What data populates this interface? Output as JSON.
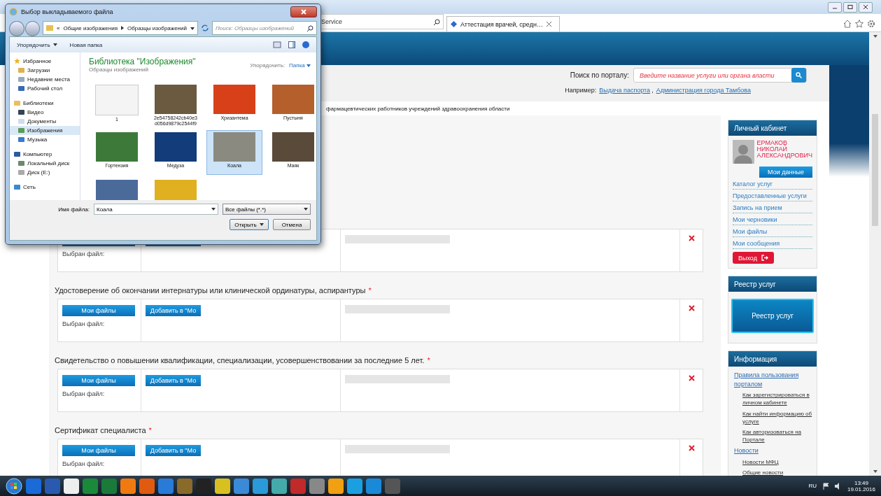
{
  "browser": {
    "address": "Service",
    "tab": {
      "title": "Аттестация врачей, средн…",
      "selected": true
    }
  },
  "portal": {
    "search_label": "Поиск по порталу:",
    "search_placeholder": "Введите название услуги или органа власти",
    "example_label": "Например:",
    "example_links": [
      "Выдача паспорта",
      "Администрация города Тамбова"
    ],
    "example_separator": ",",
    "breadcrumb": "фармацевтических работников учреждений здравоохранения области"
  },
  "sections": [
    {
      "selected_label": "Выбран файл:"
    },
    {
      "title": "Удостоверение об окончании интернатуры или клинической ординатуры, аспирантуры",
      "required_mark": "*",
      "files_button": "Мои файлы",
      "selected_label": "Выбран файл:",
      "add_button": "Добавить в \"Мо"
    },
    {
      "title": "Свидетельство о повышении квалификации, специализации, усовершенствовании за последние 5 лет.",
      "required_mark": "*",
      "files_button": "Мои файлы",
      "selected_label": "Выбран файл:",
      "add_button": "Добавить в \"Мо"
    },
    {
      "title": "Сертификат специалиста",
      "required_mark": "*",
      "files_button": "Мои файлы",
      "selected_label": "Выбран файл:",
      "add_button": "Добавить в \"Мо"
    }
  ],
  "sidebar": {
    "cabinet": {
      "title": "Личный кабинет",
      "name_lines": [
        "ЕРМАКОВ",
        "НИКОЛАЙ",
        "АЛЕКСАНДРОВИЧ"
      ],
      "data_button": "Мои данные",
      "links": [
        "Каталог услуг",
        "Предоставленные услуги",
        "Запись на прием",
        "Мои черновики",
        "Мои файлы",
        "Мои сообщения"
      ],
      "logout": "Выход"
    },
    "registry": {
      "title": "Реестр услуг",
      "button": "Реестр услуг"
    },
    "info": {
      "title": "Информация",
      "links": [
        {
          "label": "Правила пользования порталом",
          "children": [
            {
              "label": "Как зарегистрироваться в личном кабинете"
            },
            {
              "label": "Как найти информацию об услуге"
            },
            {
              "label": "Как авторизоваться на Портале"
            }
          ]
        },
        {
          "label": "Новости",
          "children": [
            {
              "label": "Новости МФЦ"
            },
            {
              "label": "Общие новости"
            }
          ]
        }
      ]
    }
  },
  "dialog": {
    "title": "Выбор выкладываемого файла",
    "path_prefix": "«",
    "path": [
      "Общие изображения",
      "Образцы изображений"
    ],
    "search_placeholder": "Поиск: Образцы изображений",
    "toolbar": [
      {
        "label": "Упорядочить",
        "kind": "menu"
      },
      {
        "label": "Новая папка",
        "kind": "plain"
      }
    ],
    "nav": [
      {
        "label": "Избранное",
        "kind": "star",
        "selected": false,
        "children": [
          {
            "label": "Загрузки",
            "kind": "folder",
            "selected": false
          },
          {
            "label": "Недавние места",
            "kind": "places",
            "selected": false
          },
          {
            "label": "Рабочий стол",
            "kind": "desktop",
            "selected": false
          }
        ]
      },
      {
        "label": "Библиотеки",
        "kind": "library",
        "selected": false,
        "children": [
          {
            "label": "Видео",
            "kind": "video",
            "selected": false
          },
          {
            "label": "Документы",
            "kind": "document",
            "selected": false
          },
          {
            "label": "Изображения",
            "kind": "image",
            "selected": true
          },
          {
            "label": "Музыка",
            "kind": "music",
            "selected": false
          }
        ]
      },
      {
        "label": "Компьютер",
        "kind": "computer",
        "selected": false,
        "children": [
          {
            "label": "Локальный диск",
            "kind": "drive",
            "selected": false
          },
          {
            "label": "Диск (E:)",
            "kind": "disk",
            "selected": false
          }
        ]
      },
      {
        "label": "Сеть",
        "kind": "network",
        "selected": false
      }
    ],
    "library_title": "Библиотека \"Изображения\"",
    "library_subtitle": "Образцы изображений",
    "arrange_label": "Упорядочить:",
    "arrange_value": "Папка",
    "files": [
      {
        "label": "1",
        "kind": "document",
        "selected": false
      },
      {
        "label": "2e54758242cb40e3d056d9879c2544f9",
        "kind": "photo",
        "selected": false
      },
      {
        "label": "Хризантема",
        "kind": "photo",
        "selected": false
      },
      {
        "label": "Пустыня",
        "kind": "photo",
        "selected": false
      },
      {
        "label": "Гортензия",
        "kind": "photo",
        "selected": false
      },
      {
        "label": "Медуза",
        "kind": "photo",
        "selected": false
      },
      {
        "label": "Коала",
        "kind": "photo",
        "selected": true
      },
      {
        "label": "Маяк",
        "kind": "photo",
        "selected": false
      },
      {
        "kind": "photo",
        "selected": false
      },
      {
        "kind": "photo",
        "selected": false
      }
    ],
    "filename_label": "Имя файла:",
    "filename": "Коала",
    "filter": "Все файлы (*.*)",
    "buttons": [
      {
        "label": "Открыть",
        "kind": "split"
      },
      {
        "label": "Отмена",
        "kind": "plain"
      }
    ]
  },
  "taskbar": {
    "language": "RU",
    "time": "13:49",
    "date": "19.01.2016"
  }
}
